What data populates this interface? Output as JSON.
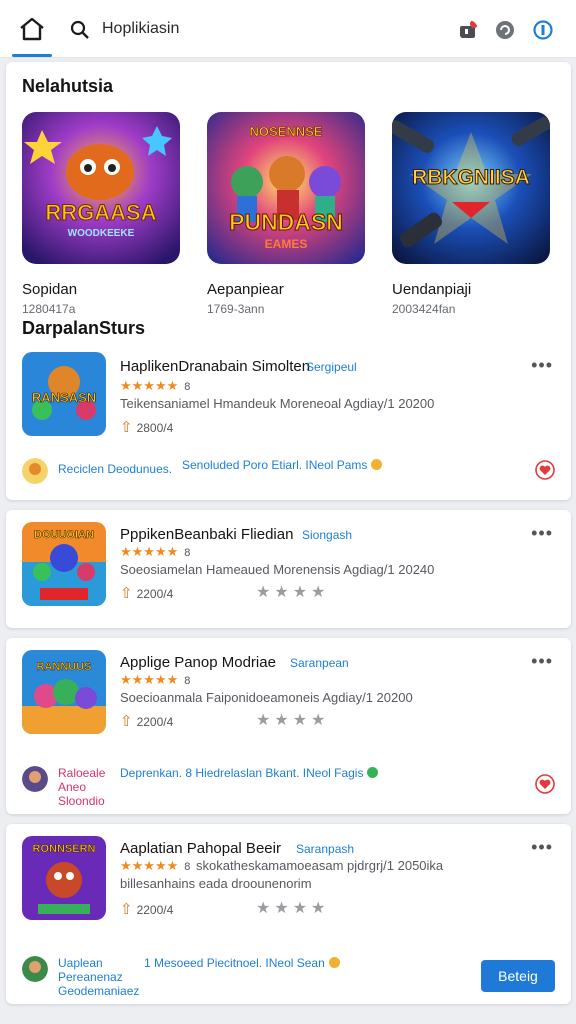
{
  "top_bar": {
    "search_text": "Hoplikiasin",
    "icons": [
      "home-icon",
      "search-icon",
      "cart-icon",
      "refresh-icon",
      "profile-icon"
    ],
    "accent": "#1d7fd8"
  },
  "featured": {
    "title": "Nelahutsia",
    "items": [
      {
        "art": "RRGAASA",
        "art_sub": "WOODKEEKE",
        "name": "Sopidan",
        "meta": "1280417a"
      },
      {
        "art": "PUNDASN",
        "art_top": "NOSENNSE",
        "art_sub": "EAMES",
        "name": "Aepanpiear",
        "meta": "1769-3ann"
      },
      {
        "art": "RBKGNIISA",
        "name": "Uendanpiaji",
        "meta": "2003424fan"
      }
    ]
  },
  "apps": {
    "title": "DarpalanSturs",
    "items": [
      {
        "art": "RANSASN",
        "title": "HaplikenDranabain Simolten",
        "tag": "Sergipeul",
        "rating_count": "8",
        "desc": "Teikensaniamel Hmandeuk Moreneoal Agdiay/1 20200",
        "downloads": "2800/4",
        "footer_link": "Reciclen Deodunues.",
        "footer_mid": "Senoluded Poro Etiarl. INeol Pams"
      },
      {
        "art": "DOUUOIAN",
        "title": "PppikenBeanbaki Fliedian",
        "tag": "Siongash",
        "rating_count": "8",
        "desc": "Soeosiamelan Hameaued Morenensis Agdiag/1 20240",
        "downloads": "2200/4"
      },
      {
        "art": "RANNUUS",
        "title": "Applige Panop Modriae",
        "tag": "Saranpean",
        "rating_count": "8",
        "desc": "Soecioanmala Faiponidoeamoneis Agdiay/1 20200",
        "downloads": "2200/4",
        "footer_link": "Raloeale Aneo Sloondio",
        "footer_mid": "Deprenkan. 8 Hiedrelaslan Bkant. INeol Fagis"
      },
      {
        "art": "RONNSERN",
        "title": "Aaplatian Pahopal Beeir",
        "tag": "Saranpash",
        "rating_count": "8",
        "desc": "skokatheskamamoeasam pjdrgrj/1 2050ika",
        "desc2": "billesanhains eada droounenorim",
        "downloads": "2200/4",
        "footer_link": "Uaplean Pereanenaz Geodemaniaez",
        "footer_mid": "1 Mesoeed Piecitnoel. INeol Sean",
        "button": "Beteig"
      }
    ]
  }
}
